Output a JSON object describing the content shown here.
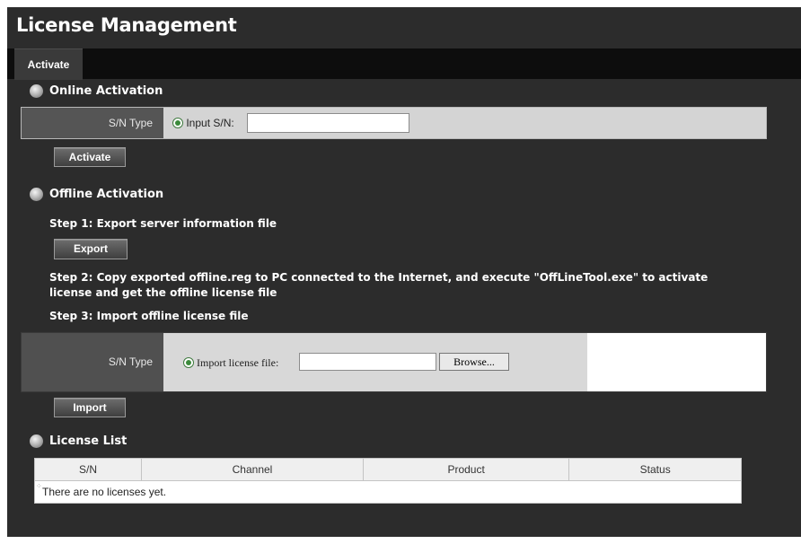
{
  "page": {
    "title": "License Management"
  },
  "tabs": [
    {
      "label": "Activate"
    }
  ],
  "online": {
    "heading": "Online Activation",
    "sn_type_label": "S/N Type",
    "radio_label": "Input S/N:",
    "input_value": "",
    "activate_button": "Activate"
  },
  "offline": {
    "heading": "Offline Activation",
    "step1": "Step 1: Export server information file",
    "export_button": "Export",
    "step2_line1": "Step 2: Copy exported offline.reg to PC connected to the Internet, and execute \"OffLineTool.exe\" to activate",
    "step2_line2": "license and get the offline license file",
    "step3": "Step 3: Import offline license file",
    "sn_type_label": "S/N Type",
    "radio_label": "Import license file:",
    "file_value": "",
    "browse_button": "Browse...",
    "import_button": "Import"
  },
  "license_list": {
    "heading": "License List",
    "columns": [
      "S/N",
      "Channel",
      "Product",
      "Status"
    ],
    "empty_message": "There are no licenses yet."
  }
}
